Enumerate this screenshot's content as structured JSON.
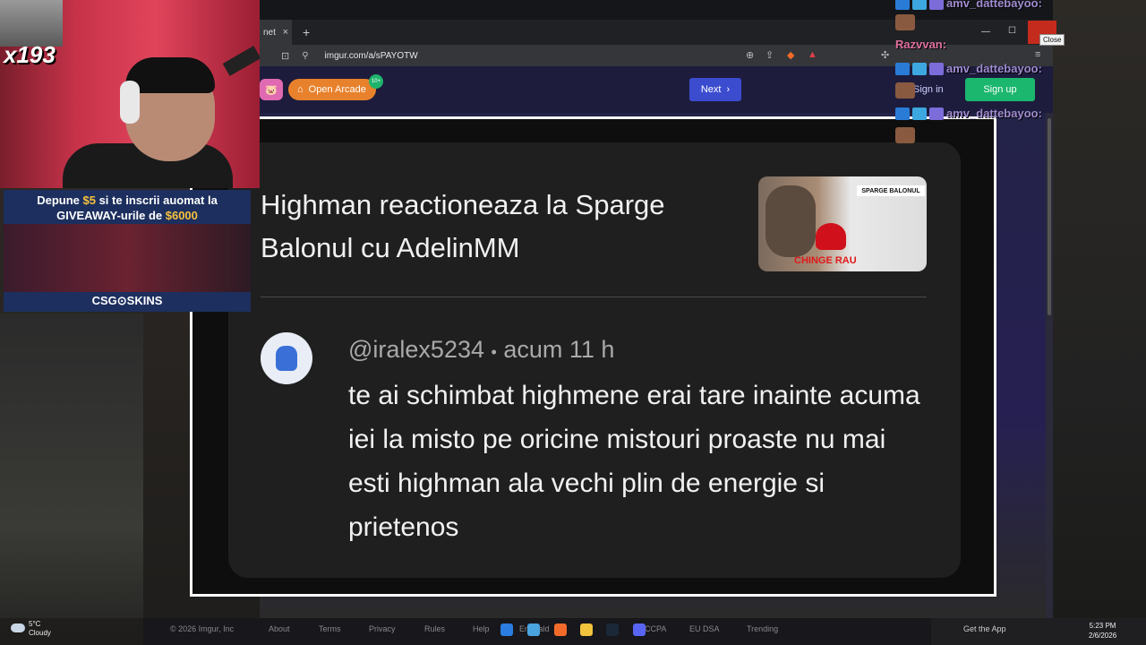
{
  "browser": {
    "tab_label": "net",
    "tab_close": "×",
    "new_tab": "+",
    "url": "imgur.com/a/sPAYOTW"
  },
  "imgur": {
    "arcade_label": "Open Arcade",
    "arcade_badge": "10+",
    "next_label": "Next",
    "signin_label": "Sign in",
    "signup_label": "Sign up"
  },
  "post_image": {
    "video_title": "Highman reactioneaza la Sparge Balonul cu AdelinMM",
    "thumbnail_label": "SPARGE BALONUL",
    "thumbnail_caption": "CHINGE RAU",
    "comment_author": "@iralex5234",
    "comment_sep": "•",
    "comment_time": "acum 11 h",
    "comment_text": "te ai schimbat highmene  erai tare inainte acuma iei la misto pe oricine mistouri proaste nu mai esti highman ala vechi plin de energie si prietenos"
  },
  "footer": {
    "copyright": "© 2026 Imgur, Inc",
    "about": "About",
    "terms": "Terms",
    "privacy": "Privacy",
    "rules": "Rules",
    "help": "Help",
    "emerald": "Emerald",
    "ccpa": "CCPA",
    "eu_dsa": "EU DSA",
    "trending": "Trending",
    "get_app": "Get the App"
  },
  "system": {
    "weather_temp": "5°C",
    "weather_desc": "Cloudy",
    "time": "5:23 PM",
    "date": "2/6/2026",
    "close_tooltip": "Close"
  },
  "stream": {
    "sub_count": "x193",
    "promo_line1_prefix": "Depune ",
    "promo_amount1": "$5",
    "promo_line1_suffix": " si te inscrii auomat la",
    "promo_line2_prefix": "GIVEAWAY-urile de ",
    "promo_amount2": "$6000",
    "promo_brand": "CSG⊙SKINS"
  },
  "chat": [
    {
      "name": "amv_dattebayoo:"
    },
    {
      "name": "Razvvan:"
    },
    {
      "name": "amv_dattebayoo:"
    },
    {
      "name": "amv_dattebayoo:"
    }
  ],
  "colors": {
    "chat_name_purple": "#a08ccf",
    "chat_name_pink": "#e070a0",
    "next_button": "#3b4ccf",
    "signup_button": "#1bb76e",
    "arcade_button": "#e8812b"
  }
}
